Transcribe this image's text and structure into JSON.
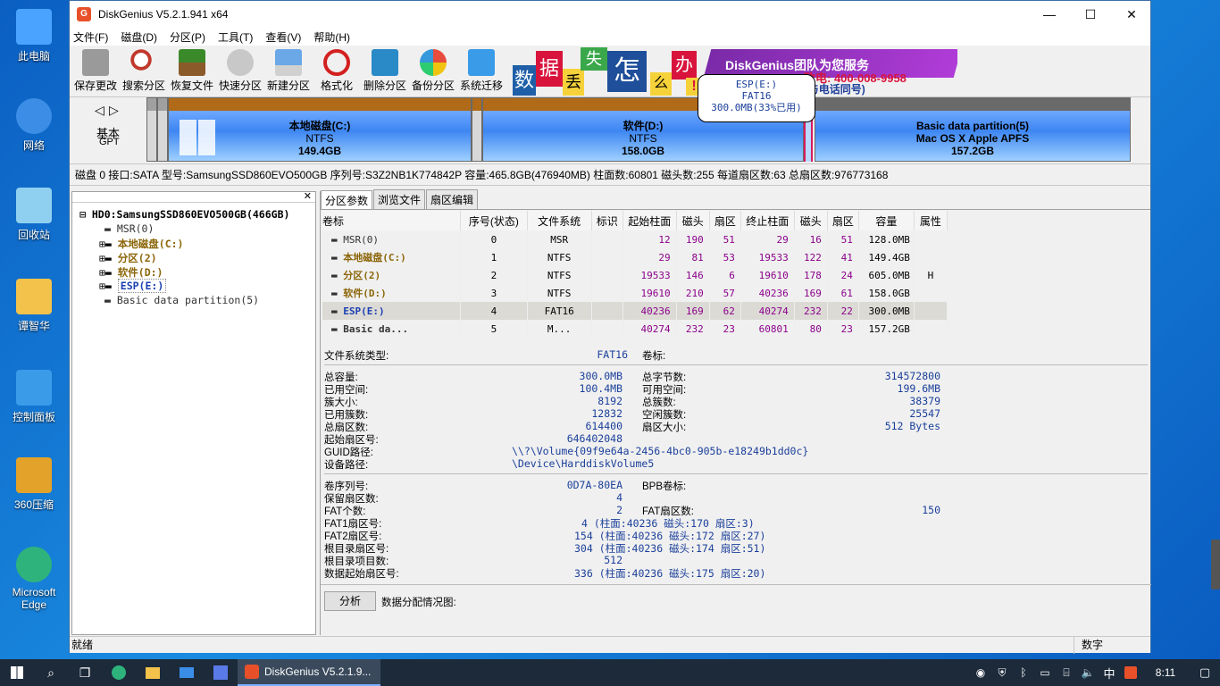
{
  "desktop": {
    "icons": [
      {
        "label": "此电脑",
        "color": "#4aa3ff"
      },
      {
        "label": "网络",
        "color": "#3b8de6"
      },
      {
        "label": "回收站",
        "color": "#8fd0f0"
      },
      {
        "label": "谭智华",
        "color": "#f2c24a"
      },
      {
        "label": "控制面板",
        "color": "#3a9be8"
      },
      {
        "label": "360压缩",
        "color": "#e3a22a"
      },
      {
        "label": "Microsoft Edge",
        "color": "#2fb37c"
      }
    ]
  },
  "window": {
    "title": "DiskGenius V5.2.1.941 x64",
    "menu": [
      "文件(F)",
      "磁盘(D)",
      "分区(P)",
      "工具(T)",
      "查看(V)",
      "帮助(H)"
    ],
    "toolbar": [
      "保存更改",
      "搜索分区",
      "恢复文件",
      "快速分区",
      "新建分区",
      "格式化",
      "删除分区",
      "备份分区",
      "系统迁移"
    ],
    "banner": {
      "chars": [
        "数",
        "据",
        "丢",
        "失",
        "怎",
        "么",
        "办",
        "!"
      ],
      "slogan": "DiskGenius团队为您服务",
      "phone": "致电: 400-008-9958",
      "qq": "QQ: 4000089958(与电话同号)"
    }
  },
  "diskmap": {
    "nav_left": "◁",
    "nav_right": "▷",
    "disk_type": "基本",
    "disk_style": "GPT",
    "partitions": [
      {
        "name": "本地磁盘(C:)",
        "fs": "NTFS",
        "size": "149.4GB"
      },
      {
        "name": "软件(D:)",
        "fs": "NTFS",
        "size": "158.0GB"
      },
      {
        "name": "Basic data partition(5)",
        "fs": "Mac OS X Apple APFS",
        "size": "157.2GB"
      }
    ],
    "tooltip": {
      "line1": "ESP(E:)",
      "line2": "FAT16",
      "line3": "300.0MB(33%已用)"
    }
  },
  "diskinfo": "磁盘 0 接口:SATA  型号:SamsungSSD860EVO500GB  序列号:S3Z2NB1K774842P  容量:465.8GB(476940MB)  柱面数:60801  磁头数:255  每道扇区数:63  总扇区数:976773168",
  "tree": {
    "root": "HD0:SamsungSSD860EVO500GB(466GB)",
    "items": [
      "MSR(0)",
      "本地磁盘(C:)",
      "分区(2)",
      "软件(D:)",
      "ESP(E:)",
      "Basic data partition(5)"
    ]
  },
  "tabs": [
    "分区参数",
    "浏览文件",
    "扇区编辑"
  ],
  "table": {
    "headers": [
      "卷标",
      "序号(状态)",
      "文件系统",
      "标识",
      "起始柱面",
      "磁头",
      "扇区",
      "终止柱面",
      "磁头",
      "扇区",
      "容量",
      "属性"
    ],
    "rows": [
      [
        "MSR(0)",
        "0",
        "MSR",
        "",
        "12",
        "190",
        "51",
        "29",
        "16",
        "51",
        "128.0MB",
        ""
      ],
      [
        "本地磁盘(C:)",
        "1",
        "NTFS",
        "",
        "29",
        "81",
        "53",
        "19533",
        "122",
        "41",
        "149.4GB",
        ""
      ],
      [
        "分区(2)",
        "2",
        "NTFS",
        "",
        "19533",
        "146",
        "6",
        "19610",
        "178",
        "24",
        "605.0MB",
        "H"
      ],
      [
        "软件(D:)",
        "3",
        "NTFS",
        "",
        "19610",
        "210",
        "57",
        "40236",
        "169",
        "61",
        "158.0GB",
        ""
      ],
      [
        "ESP(E:)",
        "4",
        "FAT16",
        "",
        "40236",
        "169",
        "62",
        "40274",
        "232",
        "22",
        "300.0MB",
        ""
      ],
      [
        "Basic da...",
        "5",
        "M...",
        "",
        "40274",
        "232",
        "23",
        "60801",
        "80",
        "23",
        "157.2GB",
        ""
      ]
    ]
  },
  "info": {
    "fs_type_label": "文件系统类型:",
    "fs_type": "FAT16",
    "vol_label": "卷标:",
    "total_cap_label": "总容量:",
    "total_cap": "300.0MB",
    "total_bytes_label": "总字节数:",
    "total_bytes": "314572800",
    "used_label": "已用空间:",
    "used": "100.4MB",
    "free_label": "可用空间:",
    "free": "199.6MB",
    "cluster_label": "簇大小:",
    "cluster": "8192",
    "total_clusters_label": "总簇数:",
    "total_clusters": "38379",
    "used_clusters_label": "已用簇数:",
    "used_clusters": "12832",
    "free_clusters_label": "空闲簇数:",
    "free_clusters": "25547",
    "total_sectors_label": "总扇区数:",
    "total_sectors": "614400",
    "sector_size_label": "扇区大小:",
    "sector_size": "512 Bytes",
    "start_sector_label": "起始扇区号:",
    "start_sector": "646402048",
    "guid_label": "GUID路径:",
    "guid": "\\\\?\\Volume{09f9e64a-2456-4bc0-905b-e18249b1dd0c}",
    "device_label": "设备路径:",
    "device": "\\Device\\HarddiskVolume5",
    "serial_label": "卷序列号:",
    "serial": "0D7A-80EA",
    "bpb_label": "BPB卷标:",
    "reserved_label": "保留扇区数:",
    "reserved": "4",
    "fat_count_label": "FAT个数:",
    "fat_count": "2",
    "fat_sectors_label": "FAT扇区数:",
    "fat_sectors": "150",
    "fat1_label": "FAT1扇区号:",
    "fat1": "4 (柱面:40236 磁头:170 扇区:3)",
    "fat2_label": "FAT2扇区号:",
    "fat2": "154 (柱面:40236 磁头:172 扇区:27)",
    "root_sector_label": "根目录扇区号:",
    "root_sector": "304 (柱面:40236 磁头:174 扇区:51)",
    "root_entries_label": "根目录项目数:",
    "root_entries": "512",
    "data_start_label": "数据起始扇区号:",
    "data_start": "336 (柱面:40236 磁头:175 扇区:20)",
    "analyze_button": "分析",
    "alloc_label": "数据分配情况图:"
  },
  "status": {
    "left": "就绪",
    "right": "数字"
  },
  "taskbar": {
    "app_label": "DiskGenius V5.2.1.9...",
    "ime": "中",
    "time": "8:11"
  }
}
